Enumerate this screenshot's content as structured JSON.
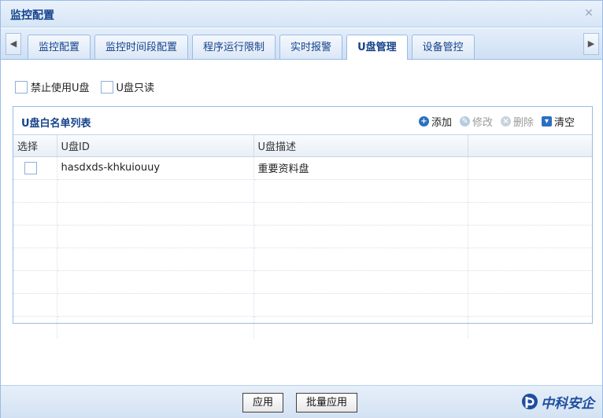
{
  "window": {
    "title": "监控配置"
  },
  "tabs": [
    {
      "label": "监控配置",
      "active": false
    },
    {
      "label": "监控时间段配置",
      "active": false
    },
    {
      "label": "程序运行限制",
      "active": false
    },
    {
      "label": "实时报警",
      "active": false
    },
    {
      "label": "U盘管理",
      "active": true
    },
    {
      "label": "设备管控",
      "active": false
    }
  ],
  "options": {
    "disable_usb": {
      "label": "禁止使用U盘",
      "checked": false
    },
    "usb_readonly": {
      "label": "U盘只读",
      "checked": false
    }
  },
  "whitelist": {
    "title": "U盘白名单列表",
    "toolbar": {
      "add": "添加",
      "edit": "修改",
      "delete": "删除",
      "clear": "清空"
    },
    "columns": [
      "选择",
      "U盘ID",
      "U盘描述",
      ""
    ],
    "rows": [
      {
        "checked": false,
        "usb_id": "hasdxds-khkuiouuy",
        "description": "重要资料盘"
      }
    ]
  },
  "footer": {
    "apply_label": "应用",
    "batch_apply_label": "批量应用",
    "logo_text": "中科安企"
  },
  "colors": {
    "accent": "#15428b",
    "border": "#99bbe8",
    "icon_blue": "#2b6fc1"
  }
}
